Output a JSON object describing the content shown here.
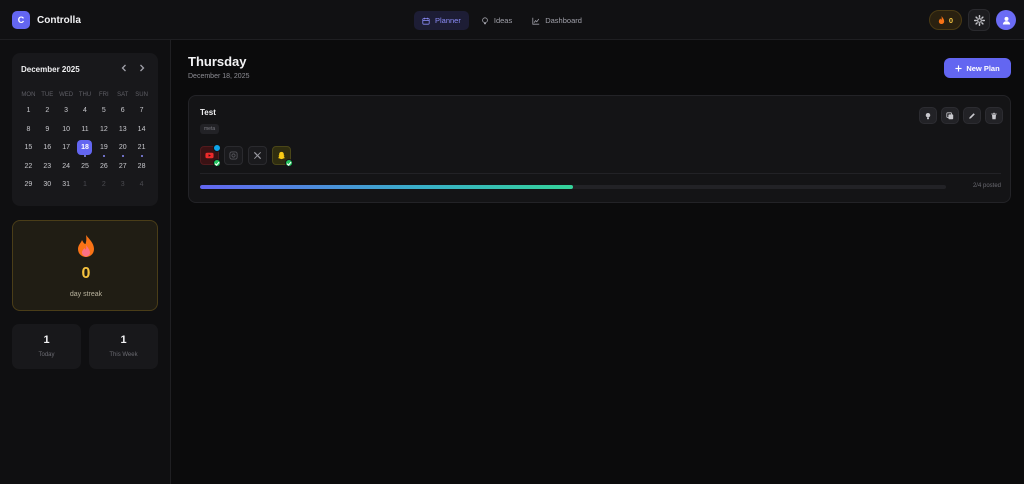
{
  "app": {
    "logo_letter": "C",
    "name": "Controlla"
  },
  "nav": {
    "tabs": [
      {
        "label": "Planner",
        "icon": "calendar-icon",
        "active": true
      },
      {
        "label": "Ideas",
        "icon": "lightbulb-icon",
        "active": false
      },
      {
        "label": "Dashboard",
        "icon": "chart-icon",
        "active": false
      }
    ]
  },
  "header": {
    "streak_count": "0",
    "icons": [
      "flame-icon",
      "gear-icon",
      "user-icon"
    ]
  },
  "calendar": {
    "month_label": "December 2025",
    "weekdays": [
      "MON",
      "TUE",
      "WED",
      "THU",
      "FRI",
      "SAT",
      "SUN"
    ],
    "days": [
      {
        "n": "1"
      },
      {
        "n": "2"
      },
      {
        "n": "3"
      },
      {
        "n": "4"
      },
      {
        "n": "5"
      },
      {
        "n": "6"
      },
      {
        "n": "7"
      },
      {
        "n": "8"
      },
      {
        "n": "9"
      },
      {
        "n": "10"
      },
      {
        "n": "11"
      },
      {
        "n": "12"
      },
      {
        "n": "13"
      },
      {
        "n": "14"
      },
      {
        "n": "15"
      },
      {
        "n": "16"
      },
      {
        "n": "17"
      },
      {
        "n": "18",
        "today": true,
        "dot": true
      },
      {
        "n": "19",
        "dot": true
      },
      {
        "n": "20",
        "dot": true
      },
      {
        "n": "21",
        "dot": true
      },
      {
        "n": "22"
      },
      {
        "n": "23"
      },
      {
        "n": "24"
      },
      {
        "n": "25"
      },
      {
        "n": "26"
      },
      {
        "n": "27"
      },
      {
        "n": "28"
      },
      {
        "n": "29"
      },
      {
        "n": "30"
      },
      {
        "n": "31"
      },
      {
        "n": "1",
        "muted": true
      },
      {
        "n": "2",
        "muted": true
      },
      {
        "n": "3",
        "muted": true
      },
      {
        "n": "4",
        "muted": true
      }
    ]
  },
  "streak": {
    "count": "0",
    "label": "day streak"
  },
  "stats": {
    "today": {
      "value": "1",
      "label": "Today"
    },
    "week": {
      "value": "1",
      "label": "This Week"
    }
  },
  "main": {
    "day_name": "Thursday",
    "date": "December 18, 2025",
    "new_plan_label": "New Plan"
  },
  "plan": {
    "title": "Test",
    "tag": "meta",
    "platforms": [
      {
        "name": "youtube",
        "posted": true,
        "scheduled": true
      },
      {
        "name": "instagram",
        "posted": false,
        "scheduled": false
      },
      {
        "name": "x",
        "posted": false,
        "scheduled": false
      },
      {
        "name": "snapchat",
        "posted": true,
        "scheduled": false
      }
    ],
    "progress_fraction": 0.5,
    "progress_label": "2/4 posted"
  },
  "colors": {
    "accent": "#6366f1",
    "streak": "#f5c23e",
    "success": "#22c55e"
  }
}
